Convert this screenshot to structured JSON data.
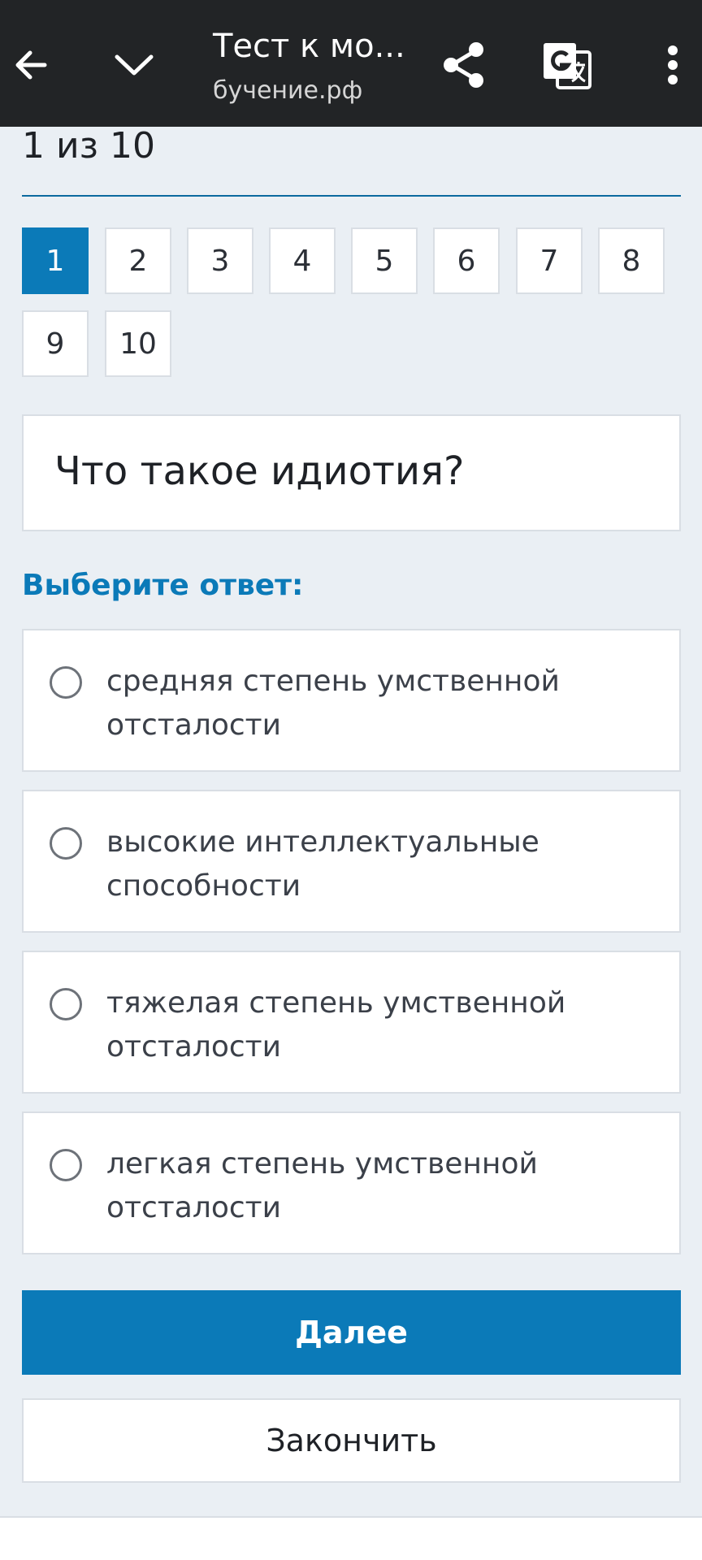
{
  "topbar": {
    "title": "Тест к мо...",
    "url": "бучение.рф",
    "icons": {
      "back": "arrow-left-icon",
      "down": "chevron-down-icon",
      "share": "share-icon",
      "translate": "translate-icon",
      "more": "more-vertical-icon"
    }
  },
  "progress": {
    "text": "1 из 10"
  },
  "question_numbers": [
    {
      "label": "1",
      "active": true
    },
    {
      "label": "2",
      "active": false
    },
    {
      "label": "3",
      "active": false
    },
    {
      "label": "4",
      "active": false
    },
    {
      "label": "5",
      "active": false
    },
    {
      "label": "6",
      "active": false
    },
    {
      "label": "7",
      "active": false
    },
    {
      "label": "8",
      "active": false
    },
    {
      "label": "9",
      "active": false
    },
    {
      "label": "10",
      "active": false
    }
  ],
  "question": {
    "text": "Что такое идиотия?"
  },
  "answer_prompt": "Выберите ответ:",
  "options": [
    "средняя степень умственной отсталости",
    "высокие интеллектуальные способности",
    "тяжелая степень умственной отсталости",
    "легкая степень умственной отсталости"
  ],
  "buttons": {
    "next": "Далее",
    "finish": "Закончить"
  },
  "colors": {
    "accent": "#0b7ab8",
    "topbar": "#222426",
    "background": "#eaeff4"
  }
}
